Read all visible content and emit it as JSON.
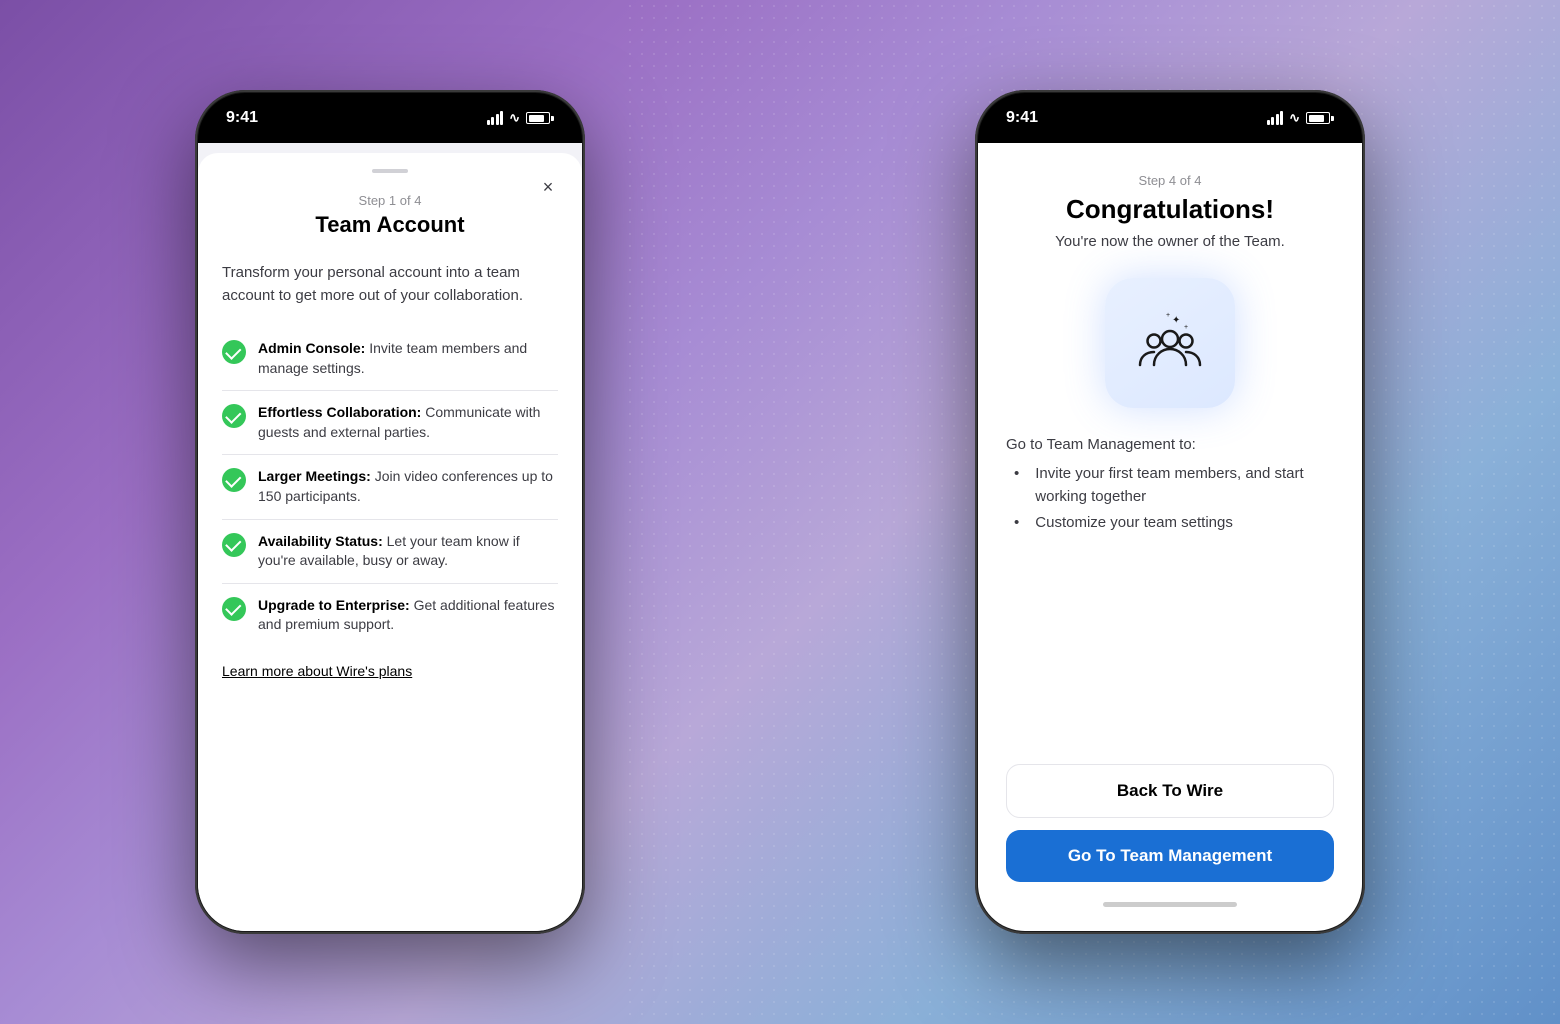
{
  "background": {
    "gradient_start": "#7b4fa6",
    "gradient_end": "#6090c8"
  },
  "phone1": {
    "status_bar": {
      "time": "9:41",
      "signal": "signal-bars",
      "wifi": "wifi",
      "battery": "battery"
    },
    "sheet": {
      "step_label": "Step 1 of 4",
      "title": "Team Account",
      "description": "Transform your personal account into a team account to get more out of your collaboration.",
      "features": [
        {
          "bold": "Admin Console:",
          "text": " Invite team members and manage settings."
        },
        {
          "bold": "Effortless Collaboration:",
          "text": " Communicate with guests and external parties."
        },
        {
          "bold": "Larger Meetings:",
          "text": " Join video conferences up to 150 participants."
        },
        {
          "bold": "Availability Status:",
          "text": " Let your team know if you're available, busy or away."
        },
        {
          "bold": "Upgrade to Enterprise:",
          "text": " Get additional features and premium support."
        }
      ],
      "learn_more_link": "Learn more about Wire's plans",
      "close_label": "×"
    }
  },
  "phone2": {
    "status_bar": {
      "time": "9:41"
    },
    "screen": {
      "step_label": "Step 4 of 4",
      "title": "Congratulations!",
      "subtitle": "You're now the owner of the Team.",
      "management_intro": "Go to Team Management to:",
      "management_items": [
        "Invite your first team members, and start working together",
        "Customize your team settings"
      ],
      "btn_back": "Back To Wire",
      "btn_team": "Go To Team Management"
    }
  }
}
